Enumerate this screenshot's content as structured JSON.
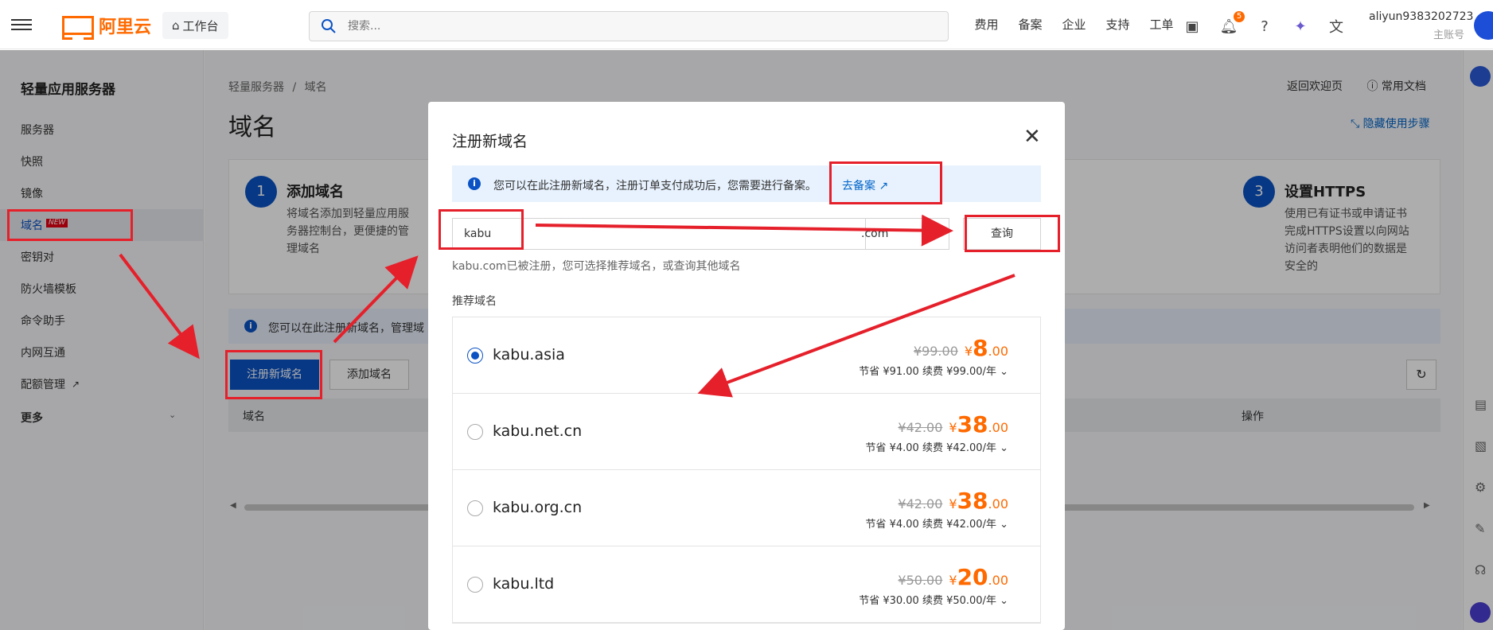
{
  "header": {
    "brand": "阿里云",
    "workbench": "工作台",
    "search_placeholder": "搜索...",
    "nav": [
      "费用",
      "备案",
      "企业",
      "支持",
      "工单"
    ],
    "notification_count": "5",
    "username": "aliyun9383202723",
    "role": "主账号"
  },
  "sidebar": {
    "title": "轻量应用服务器",
    "items": [
      "服务器",
      "快照",
      "镜像",
      "域名",
      "密钥对",
      "防火墙模板",
      "命令助手",
      "内网互通",
      "配额管理",
      "更多"
    ],
    "new_tag": "NEW"
  },
  "main": {
    "breadcrumb": [
      "轻量服务器",
      "/",
      "域名"
    ],
    "title": "域名",
    "back_home": "返回欢迎页",
    "docs": "常用文档",
    "hide_steps": "隐藏使用步骤",
    "steps": [
      {
        "num": "1",
        "title": "添加域名",
        "desc": [
          "将域名添加到轻量应用服",
          "务器控制台，更便捷的管",
          "理域名"
        ]
      },
      {
        "num": "3",
        "title": "设置HTTPS",
        "desc": [
          "使用已有证书或申请证书",
          "完成HTTPS设置以向网站",
          "访问者表明他们的数据是",
          "安全的"
        ]
      }
    ],
    "info_text": "您可以在此注册新域名，管理域",
    "btn_register": "注册新域名",
    "btn_add": "添加域名",
    "col_domain": "域名",
    "col_action": "操作"
  },
  "modal": {
    "title": "注册新域名",
    "info_text": "您可以在此注册新域名，注册订单支付成功后，您需要进行备案。",
    "info_link": "去备案",
    "input_value": "kabu",
    "tld": ".com",
    "query_btn": "查询",
    "status_text": "kabu.com已被注册，您可选择推荐域名，或查询其他域名",
    "rec_label": "推荐域名",
    "recommendations": [
      {
        "name": "kabu.asia",
        "old": "¥99.00",
        "cur_int": "8",
        "cur_dec": ".00",
        "save": "节省 ¥91.00 续费 ¥99.00/年",
        "selected": true
      },
      {
        "name": "kabu.net.cn",
        "old": "¥42.00",
        "cur_int": "38",
        "cur_dec": ".00",
        "save": "节省 ¥4.00 续费 ¥42.00/年",
        "selected": false
      },
      {
        "name": "kabu.org.cn",
        "old": "¥42.00",
        "cur_int": "38",
        "cur_dec": ".00",
        "save": "节省 ¥4.00 续费 ¥42.00/年",
        "selected": false
      },
      {
        "name": "kabu.ltd",
        "old": "¥50.00",
        "cur_int": "20",
        "cur_dec": ".00",
        "save": "节省 ¥30.00 续费 ¥50.00/年",
        "selected": false
      }
    ],
    "currency": "¥"
  },
  "colors": {
    "accent": "#0b53c4",
    "brand": "#ff6a00",
    "annotation": "#e5202b"
  }
}
